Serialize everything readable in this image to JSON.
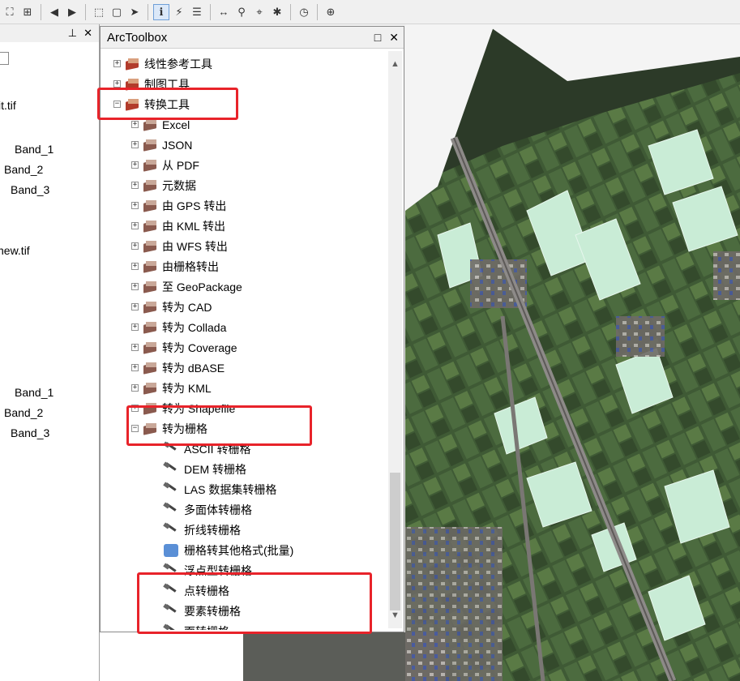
{
  "toolbar": {
    "icons": [
      "zoom-extent-icon",
      "full-extent-icon",
      "back-icon",
      "forward-icon",
      "select-features-icon",
      "clear-selection-icon",
      "select-elements-icon",
      "identify-icon",
      "hyperlink-icon",
      "html-popup-icon",
      "measure-icon",
      "find-icon",
      "go-to-xy-icon",
      "xy-icon",
      "time-slider-icon",
      "viewer-window-icon"
    ]
  },
  "toc": {
    "items": [
      "it.tif",
      "Band_1",
      "Band_2",
      "Band_3",
      "new.tif",
      "Band_1",
      "Band_2",
      "Band_3"
    ]
  },
  "arctoolbox": {
    "title": "ArcToolbox",
    "tree": [
      {
        "label": "线性参考工具",
        "level": 0,
        "kind": "toolbox",
        "expanded": false
      },
      {
        "label": "制图工具",
        "level": 0,
        "kind": "toolbox",
        "expanded": false
      },
      {
        "label": "转换工具",
        "level": 0,
        "kind": "toolbox",
        "expanded": true
      },
      {
        "label": "Excel",
        "level": 1,
        "kind": "toolset",
        "expanded": false
      },
      {
        "label": "JSON",
        "level": 1,
        "kind": "toolset",
        "expanded": false
      },
      {
        "label": "从 PDF",
        "level": 1,
        "kind": "toolset",
        "expanded": false
      },
      {
        "label": "元数据",
        "level": 1,
        "kind": "toolset",
        "expanded": false
      },
      {
        "label": "由 GPS 转出",
        "level": 1,
        "kind": "toolset",
        "expanded": false
      },
      {
        "label": "由 KML 转出",
        "level": 1,
        "kind": "toolset",
        "expanded": false
      },
      {
        "label": "由 WFS 转出",
        "level": 1,
        "kind": "toolset",
        "expanded": false
      },
      {
        "label": "由栅格转出",
        "level": 1,
        "kind": "toolset",
        "expanded": false
      },
      {
        "label": "至 GeoPackage",
        "level": 1,
        "kind": "toolset",
        "expanded": false
      },
      {
        "label": "转为 CAD",
        "level": 1,
        "kind": "toolset",
        "expanded": false
      },
      {
        "label": "转为 Collada",
        "level": 1,
        "kind": "toolset",
        "expanded": false
      },
      {
        "label": "转为 Coverage",
        "level": 1,
        "kind": "toolset",
        "expanded": false
      },
      {
        "label": "转为 dBASE",
        "level": 1,
        "kind": "toolset",
        "expanded": false
      },
      {
        "label": "转为 KML",
        "level": 1,
        "kind": "toolset",
        "expanded": false
      },
      {
        "label": "转为 Shapefile",
        "level": 1,
        "kind": "toolset",
        "expanded": false
      },
      {
        "label": "转为栅格",
        "level": 1,
        "kind": "toolset",
        "expanded": true
      },
      {
        "label": "ASCII 转栅格",
        "level": 2,
        "kind": "tool"
      },
      {
        "label": "DEM 转栅格",
        "level": 2,
        "kind": "tool"
      },
      {
        "label": "LAS 数据集转栅格",
        "level": 2,
        "kind": "tool"
      },
      {
        "label": "多面体转栅格",
        "level": 2,
        "kind": "tool"
      },
      {
        "label": "折线转栅格",
        "level": 2,
        "kind": "tool"
      },
      {
        "label": "栅格转其他格式(批量)",
        "level": 2,
        "kind": "script"
      },
      {
        "label": "浮点型转栅格",
        "level": 2,
        "kind": "tool"
      },
      {
        "label": "点转栅格",
        "level": 2,
        "kind": "tool"
      },
      {
        "label": "要素转栅格",
        "level": 2,
        "kind": "tool"
      },
      {
        "label": "面转栅格",
        "level": 2,
        "kind": "tool"
      }
    ]
  },
  "colors": {
    "highlight": "#e8232a",
    "toolbox_red": "#b23b2b"
  }
}
